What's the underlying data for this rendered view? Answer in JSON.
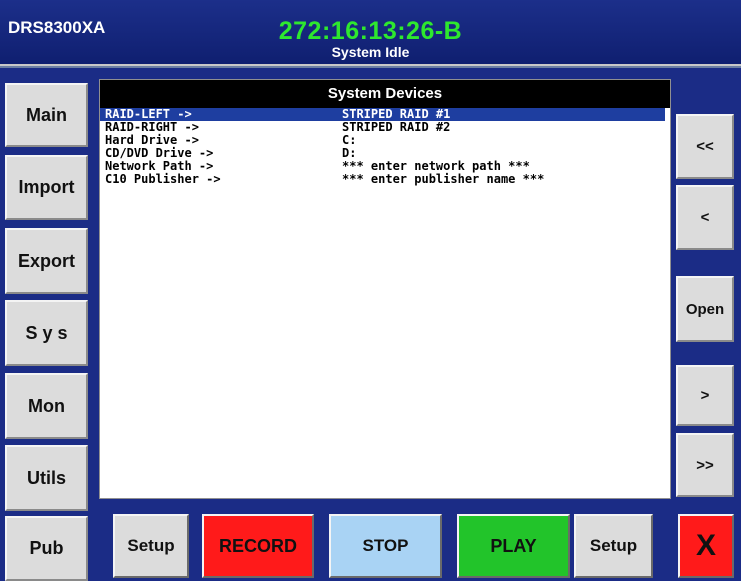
{
  "header": {
    "device_name": "DRS8300XA",
    "timecode": "272:16:13:26-B",
    "status": "System Idle"
  },
  "sidebar": {
    "items": [
      {
        "label": "Main"
      },
      {
        "label": "Import"
      },
      {
        "label": "Export"
      },
      {
        "label": "S y s"
      },
      {
        "label": "Mon"
      },
      {
        "label": "Utils"
      },
      {
        "label": "Pub"
      }
    ]
  },
  "panel": {
    "title": "System Devices",
    "devices": [
      {
        "name": "RAID-LEFT ->",
        "value": "STRIPED RAID #1",
        "selected": true
      },
      {
        "name": "RAID-RIGHT ->",
        "value": "STRIPED RAID #2"
      },
      {
        "name": "Hard Drive ->",
        "value": "C:"
      },
      {
        "name": "CD/DVD Drive ->",
        "value": "D:"
      },
      {
        "name": "Network Path ->",
        "value": "*** enter network path ***"
      },
      {
        "name": "C10 Publisher ->",
        "value": "*** enter publisher name ***"
      }
    ]
  },
  "nav": {
    "first": "<<",
    "prev": "<",
    "open": "Open",
    "next": ">",
    "last": ">>"
  },
  "transport": {
    "setup_left": "Setup",
    "record": "RECORD",
    "stop": "STOP",
    "play": "PLAY",
    "setup_right": "Setup",
    "close": "X"
  },
  "colors": {
    "frame": "#1b2c86",
    "timecode": "#2ee82e",
    "record": "#ff1a1a",
    "stop": "#a9d3f4",
    "play": "#22c42a",
    "close": "#ff1a1a",
    "selection": "#1e3ea0"
  }
}
